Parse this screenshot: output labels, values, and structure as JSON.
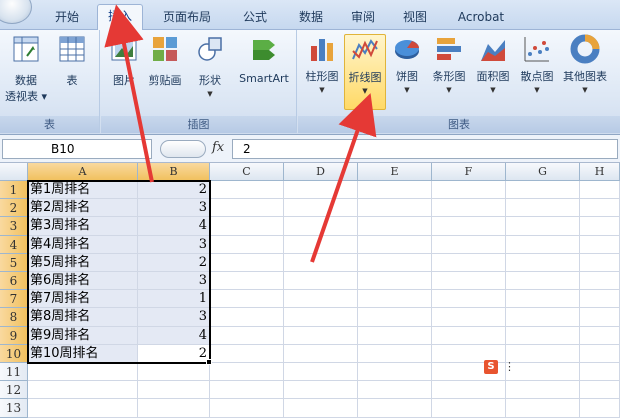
{
  "ribbon_tabs": [
    {
      "label": "开始",
      "active": false
    },
    {
      "label": "插入",
      "active": true
    },
    {
      "label": "页面布局",
      "active": false
    },
    {
      "label": "公式",
      "active": false
    },
    {
      "label": "数据",
      "active": false
    },
    {
      "label": "审阅",
      "active": false
    },
    {
      "label": "视图",
      "active": false
    },
    {
      "label": "Acrobat",
      "active": false
    }
  ],
  "groups": {
    "table": {
      "label": "表",
      "pivot_label_line1": "数据",
      "pivot_label_line2": "透视表 ▾",
      "table_label": "表"
    },
    "illustrations": {
      "label": "插图",
      "picture_label": "图片",
      "clipart_label": "剪贴画",
      "shapes_label": "形状",
      "smartart_label": "SmartArt"
    },
    "charts": {
      "label": "图表",
      "buttons": [
        "柱形图",
        "折线图",
        "饼图",
        "条形图",
        "面积图",
        "散点图",
        "其他图表"
      ]
    }
  },
  "formula_bar": {
    "name_box": "B10",
    "fx": "fx",
    "value": "2"
  },
  "columns": [
    "A",
    "B",
    "C",
    "D",
    "E",
    "F",
    "G",
    "H"
  ],
  "rows": [
    {
      "num": "1",
      "a": "第1周排名",
      "b": "2"
    },
    {
      "num": "2",
      "a": "第2周排名",
      "b": "3"
    },
    {
      "num": "3",
      "a": "第3周排名",
      "b": "4"
    },
    {
      "num": "4",
      "a": "第4周排名",
      "b": "3"
    },
    {
      "num": "5",
      "a": "第5周排名",
      "b": "2"
    },
    {
      "num": "6",
      "a": "第6周排名",
      "b": "3"
    },
    {
      "num": "7",
      "a": "第7周排名",
      "b": "1"
    },
    {
      "num": "8",
      "a": "第8周排名",
      "b": "3"
    },
    {
      "num": "9",
      "a": "第9周排名",
      "b": "4"
    },
    {
      "num": "10",
      "a": "第10周排名",
      "b": "2"
    },
    {
      "num": "11",
      "a": "",
      "b": ""
    },
    {
      "num": "12",
      "a": "",
      "b": ""
    },
    {
      "num": "13",
      "a": "",
      "b": ""
    }
  ],
  "ime_label": "S",
  "ime_extra": "⋮",
  "colors": {
    "annotation_arrow": "#e53935",
    "selection_header": "#f1c15f",
    "highlight_button": "#ffd966"
  }
}
